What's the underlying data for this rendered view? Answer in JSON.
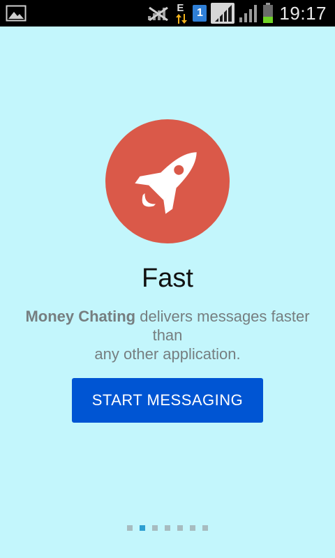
{
  "status_bar": {
    "time": "19:17",
    "network_type": "E",
    "sim_number": "1",
    "icons": [
      "gallery-icon",
      "no-signal-icon",
      "data-arrows-icon",
      "sim-icon",
      "signal-icon",
      "signal-icon",
      "battery-icon"
    ]
  },
  "colors": {
    "background": "#c3f6fc",
    "hero_circle": "#da5949",
    "button": "#0055d3",
    "active_dot": "#2d9fd1",
    "inactive_dot": "#a7bcc0"
  },
  "onboarding": {
    "icon": "rocket-icon",
    "title": "Fast",
    "description_brand": "Money Chating",
    "description_line1": "delivers messages faster",
    "description_line2": "than",
    "description_line3": "any other application.",
    "button_label": "START MESSAGING",
    "page_count": 7,
    "active_page": 2
  }
}
